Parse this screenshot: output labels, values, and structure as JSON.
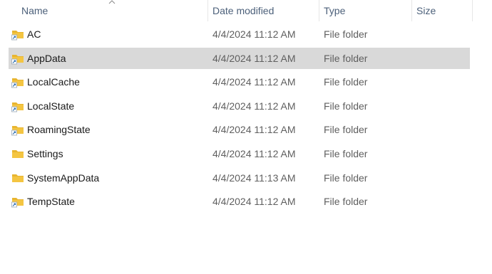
{
  "header": {
    "name_label": "Name",
    "date_label": "Date modified",
    "type_label": "Type",
    "size_label": "Size",
    "sort_icon": "sort-ascending-icon"
  },
  "rows": [
    {
      "name": "AC",
      "date": "4/4/2024 11:12 AM",
      "type": "File folder",
      "icon": "folder-shortcut-icon",
      "selected": false
    },
    {
      "name": "AppData",
      "date": "4/4/2024 11:12 AM",
      "type": "File folder",
      "icon": "folder-shortcut-icon",
      "selected": true
    },
    {
      "name": "LocalCache",
      "date": "4/4/2024 11:12 AM",
      "type": "File folder",
      "icon": "folder-shortcut-icon",
      "selected": false
    },
    {
      "name": "LocalState",
      "date": "4/4/2024 11:12 AM",
      "type": "File folder",
      "icon": "folder-shortcut-icon",
      "selected": false
    },
    {
      "name": "RoamingState",
      "date": "4/4/2024 11:12 AM",
      "type": "File folder",
      "icon": "folder-shortcut-icon",
      "selected": false
    },
    {
      "name": "Settings",
      "date": "4/4/2024 11:12 AM",
      "type": "File folder",
      "icon": "folder-icon",
      "selected": false
    },
    {
      "name": "SystemAppData",
      "date": "4/4/2024 11:13 AM",
      "type": "File folder",
      "icon": "folder-icon",
      "selected": false
    },
    {
      "name": "TempState",
      "date": "4/4/2024 11:12 AM",
      "type": "File folder",
      "icon": "folder-shortcut-icon",
      "selected": false
    }
  ],
  "colors": {
    "selected_row": "#d9d9d9",
    "header_text": "#4c607a",
    "folder_yellow": "#f4c542",
    "shortcut_arrow": "#2b6cb0"
  }
}
